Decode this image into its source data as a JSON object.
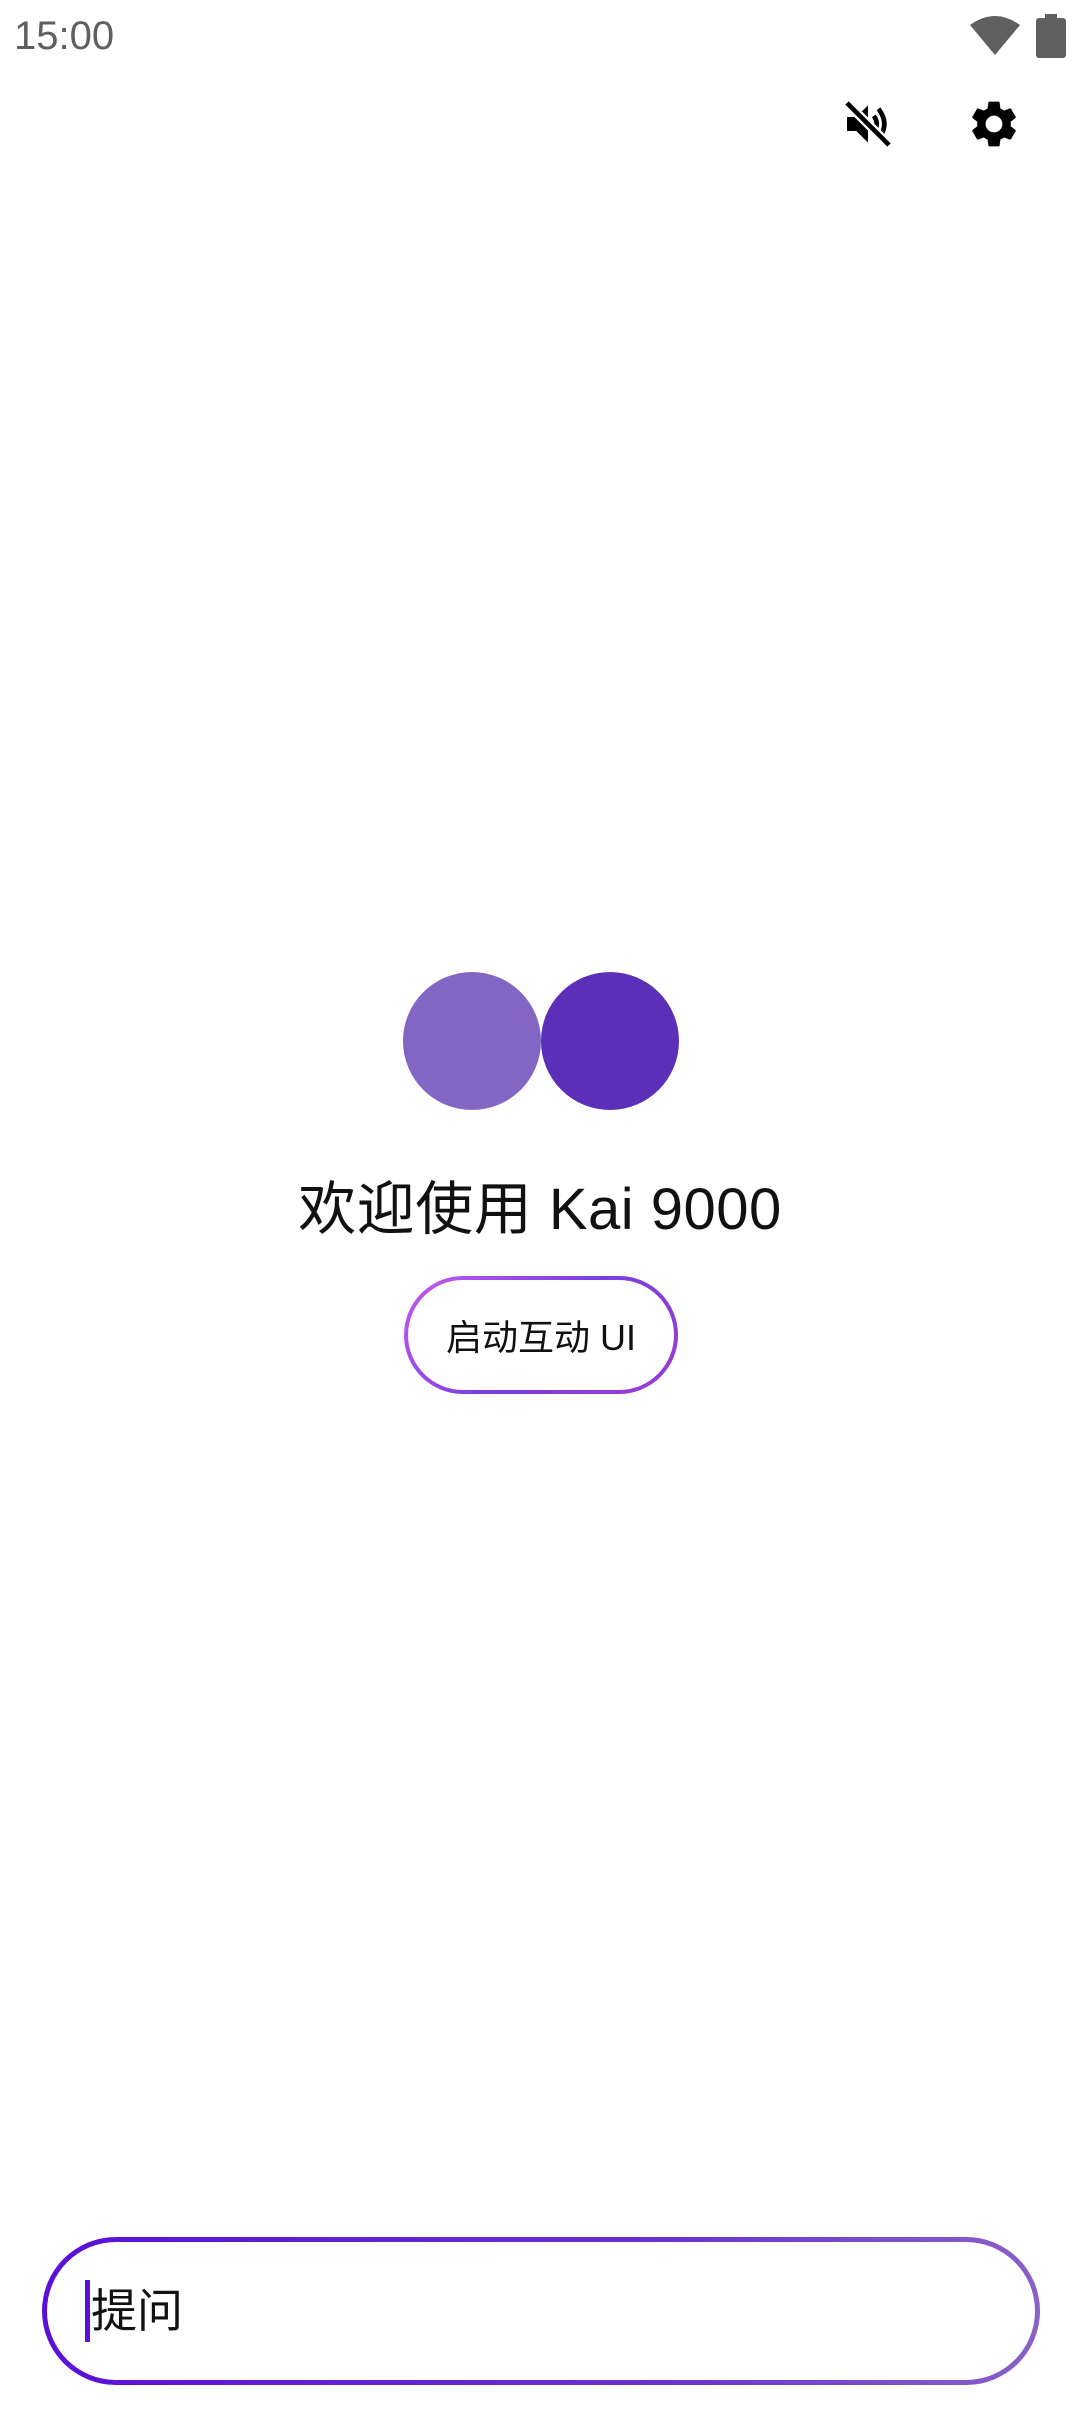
{
  "status_bar": {
    "time": "15:00",
    "icons": [
      "wifi-icon",
      "battery-icon"
    ]
  },
  "action_bar": {
    "icons": [
      "volume-off-icon",
      "settings-gear-icon"
    ]
  },
  "welcome": {
    "title": "欢迎使用 Kai 9000",
    "logo_colors": [
      "#8366c4",
      "#5b2fb8"
    ]
  },
  "interactive_button": {
    "label": "启动互动 UI"
  },
  "prompt": {
    "placeholder": "提问",
    "value": ""
  },
  "colors": {
    "accent": "#5a10d8",
    "status_text": "#5f5f5f"
  }
}
